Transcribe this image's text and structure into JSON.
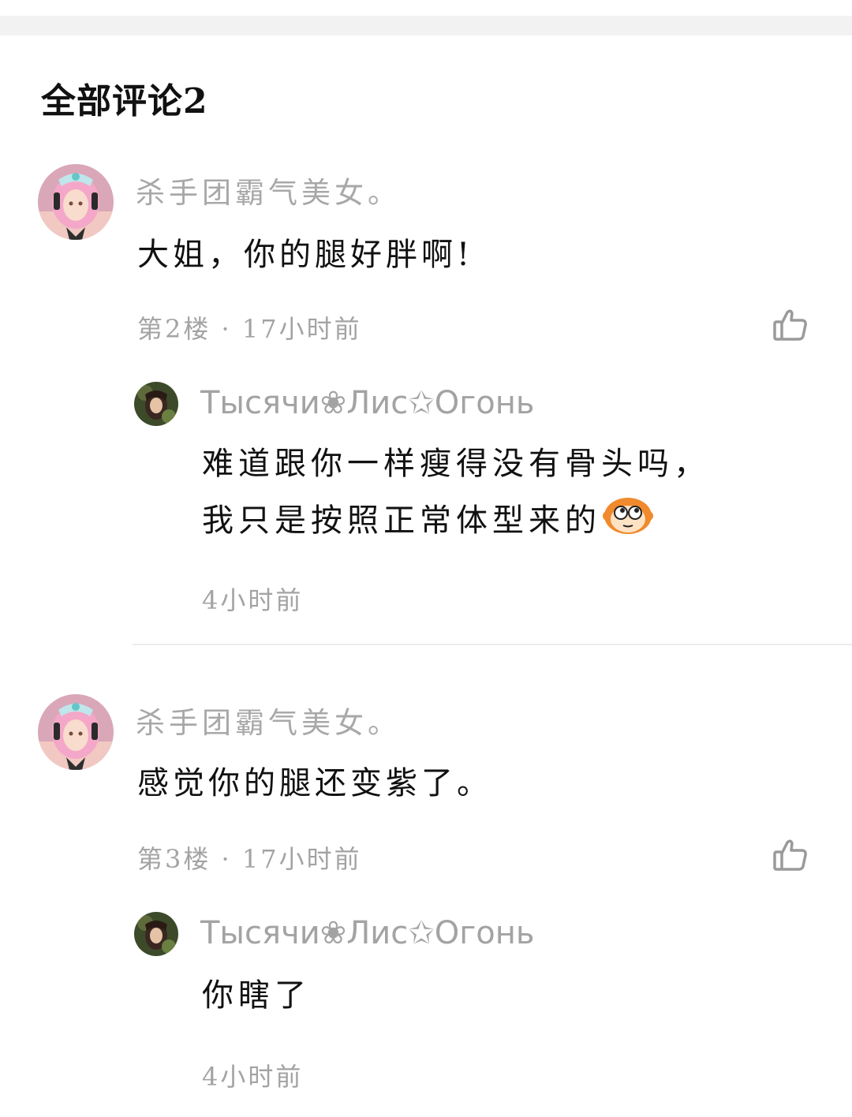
{
  "section": {
    "title": "全部评论2"
  },
  "comments": [
    {
      "author": "杀手团霸气美女。",
      "text": "大姐，你的腿好胖啊!",
      "meta": "第2楼 · 17小时前",
      "reply": {
        "author": "Тысячи❀Лис✩Огонь",
        "lines": [
          "难道跟你一样瘦得没有骨头吗，",
          "我只是按照正常体型来的"
        ],
        "emoji": "monkey-emoji",
        "meta": "4小时前"
      }
    },
    {
      "author": "杀手团霸气美女。",
      "text": "感觉你的腿还变紫了。",
      "meta": "第3楼 · 17小时前",
      "reply": {
        "author": "Тысячи❀Лис✩Огонь",
        "lines": [
          "你瞎了"
        ],
        "meta": "4小时前"
      }
    }
  ],
  "icons": {
    "like": "thumbs-up-icon"
  },
  "colors": {
    "text_primary": "#111111",
    "text_secondary": "#a3a3a3",
    "divider": "#ececec",
    "top_strip": "#f2f2f2"
  }
}
